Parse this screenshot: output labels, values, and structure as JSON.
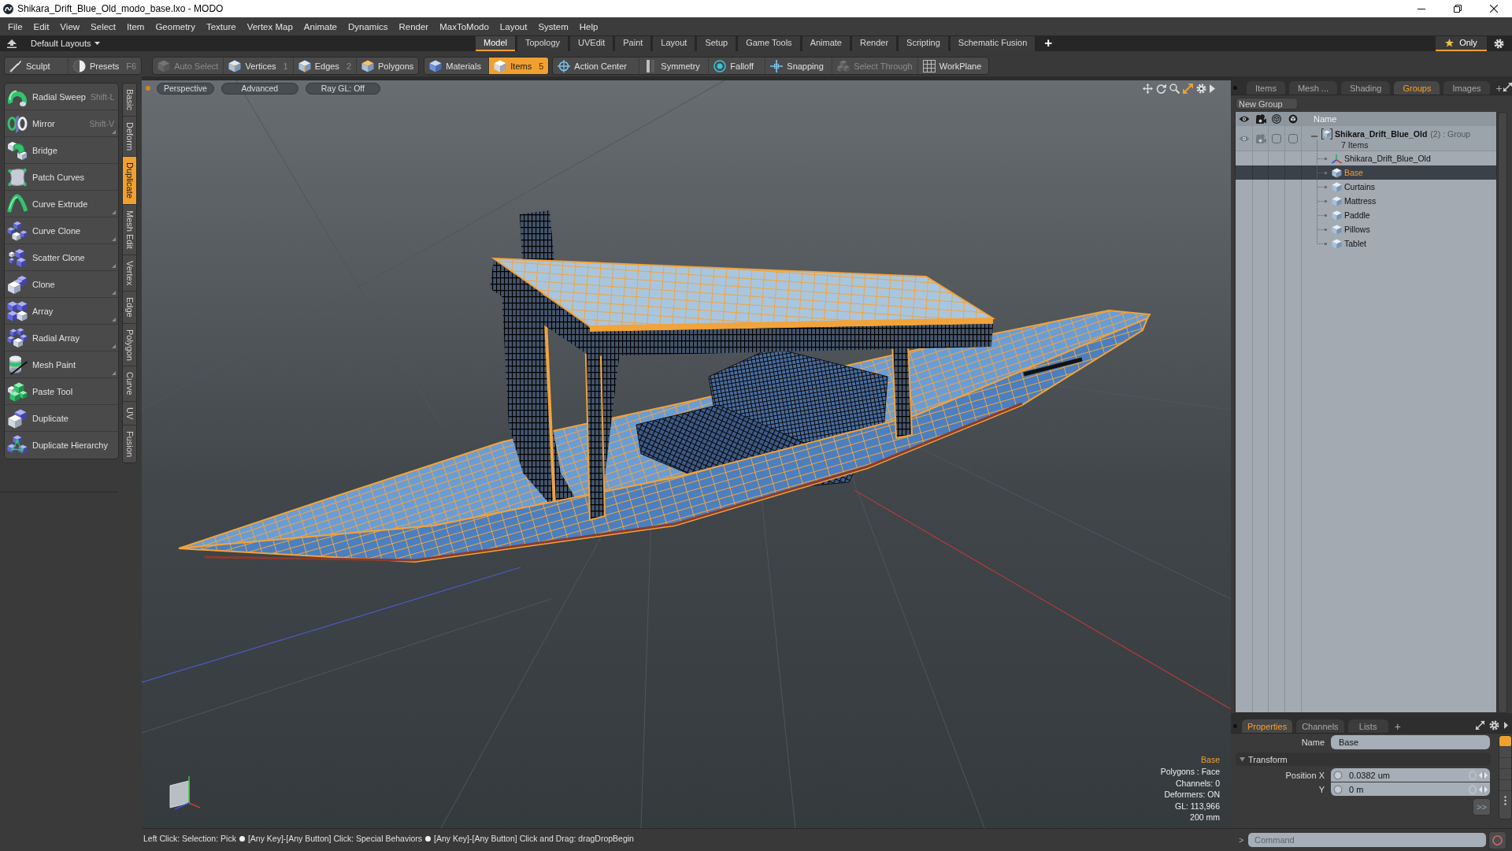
{
  "window": {
    "title": "Shikara_Drift_Blue_Old_modo_base.lxo - MODO"
  },
  "menu_bar": [
    "File",
    "Edit",
    "View",
    "Select",
    "Item",
    "Geometry",
    "Texture",
    "Vertex Map",
    "Animate",
    "Dynamics",
    "Render",
    "MaxToModo",
    "Layout",
    "System",
    "Help"
  ],
  "layout_bar": {
    "layouts_menu": "Default Layouts",
    "tabs": [
      {
        "label": "Model",
        "selected": true
      },
      {
        "label": "Topology",
        "selected": false
      },
      {
        "label": "UVEdit",
        "selected": false
      },
      {
        "label": "Paint",
        "selected": false
      },
      {
        "label": "Layout",
        "selected": false
      },
      {
        "label": "Setup",
        "selected": false
      },
      {
        "label": "Game Tools",
        "selected": false
      },
      {
        "label": "Animate",
        "selected": false
      },
      {
        "label": "Render",
        "selected": false
      },
      {
        "label": "Scripting",
        "selected": false
      },
      {
        "label": "Schematic Fusion",
        "selected": false
      }
    ],
    "add_tab": "+",
    "filter": {
      "label": "Only",
      "on": true
    }
  },
  "toolbar": {
    "groups": [
      {
        "items": [
          {
            "label": "Sculpt",
            "selected": false,
            "disabled": false
          },
          {
            "label": "Presets",
            "shortcut": "F6",
            "selected": false,
            "disabled": false
          }
        ]
      },
      {
        "items": [
          {
            "label": "Auto Select",
            "selected": false,
            "disabled": true
          },
          {
            "label": "Vertices",
            "shortcut": "1",
            "selected": false,
            "disabled": false
          },
          {
            "label": "Edges",
            "shortcut": "2",
            "selected": false,
            "disabled": false
          },
          {
            "label": "Polygons",
            "selected": false,
            "disabled": false
          }
        ]
      },
      {
        "items": [
          {
            "label": "Materials",
            "selected": false,
            "disabled": false
          },
          {
            "label": "Items",
            "shortcut": "5",
            "selected": true,
            "disabled": false
          }
        ]
      },
      {
        "items": [
          {
            "label": "Action Center",
            "selected": false,
            "disabled": false
          },
          {
            "label": "Symmetry",
            "selected": false,
            "disabled": false
          },
          {
            "label": "Falloff",
            "selected": false,
            "disabled": false
          },
          {
            "label": "Snapping",
            "selected": false,
            "disabled": false
          },
          {
            "label": "Select Through",
            "selected": false,
            "disabled": true
          },
          {
            "label": "WorkPlane",
            "selected": false,
            "disabled": false
          }
        ]
      }
    ]
  },
  "tool_panel": {
    "tools": [
      {
        "label": "Radial Sweep",
        "shortcut": "Shift-L",
        "has_options": false
      },
      {
        "label": "Mirror",
        "shortcut": "Shift-V",
        "has_options": true
      },
      {
        "label": "Bridge",
        "has_options": false
      },
      {
        "label": "Patch Curves",
        "has_options": false
      },
      {
        "label": "Curve Extrude",
        "has_options": true
      },
      {
        "label": "Curve Clone",
        "has_options": true
      },
      {
        "label": "Scatter Clone",
        "has_options": true
      },
      {
        "label": "Clone",
        "has_options": true
      },
      {
        "label": "Array",
        "has_options": true
      },
      {
        "label": "Radial Array",
        "has_options": true
      },
      {
        "label": "Mesh Paint",
        "has_options": true
      },
      {
        "label": "Paste Tool",
        "has_options": false
      },
      {
        "label": "Duplicate",
        "has_options": false
      },
      {
        "label": "Duplicate Hierarchy",
        "has_options": false
      }
    ],
    "tabs": [
      {
        "label": "Basic",
        "selected": false
      },
      {
        "label": "Deform",
        "selected": false
      },
      {
        "label": "Duplicate",
        "selected": true
      },
      {
        "label": "Mesh Edit",
        "selected": false
      },
      {
        "label": "Vertex",
        "selected": false
      },
      {
        "label": "Edge",
        "selected": false
      },
      {
        "label": "Polygon",
        "selected": false
      },
      {
        "label": "Curve",
        "selected": false
      },
      {
        "label": "UV",
        "selected": false
      },
      {
        "label": "Fusion",
        "selected": false
      }
    ]
  },
  "viewport": {
    "buttons": [
      "Perspective",
      "Advanced",
      "Ray GL: Off"
    ],
    "info": {
      "item": "Base",
      "lines": [
        "Polygons : Face",
        "Channels: 0",
        "Deformers: ON",
        "GL: 113,966",
        "200 mm"
      ]
    }
  },
  "groups_panel": {
    "tabs": [
      {
        "label": "Items",
        "selected": false
      },
      {
        "label": "Mesh ...",
        "selected": false
      },
      {
        "label": "Shading",
        "selected": false
      },
      {
        "label": "Groups",
        "selected": true
      },
      {
        "label": "Images",
        "selected": false
      }
    ],
    "add_tab": "+",
    "new_group": "New Group",
    "name_column": "Name",
    "tree": [
      {
        "name": "Shikara_Drift_Blue_Old",
        "count": "(2)",
        "type": ": Group",
        "summary": "7 Items",
        "expanded": true,
        "children": [
          {
            "name": "Shikara_Drift_Blue_Old",
            "kind": "locator",
            "selected": false
          },
          {
            "name": "Base",
            "kind": "mesh",
            "selected": true
          },
          {
            "name": "Curtains",
            "kind": "mesh",
            "selected": false
          },
          {
            "name": "Mattress",
            "kind": "mesh",
            "selected": false
          },
          {
            "name": "Paddle",
            "kind": "mesh",
            "selected": false
          },
          {
            "name": "Pillows",
            "kind": "mesh",
            "selected": false
          },
          {
            "name": "Tablet",
            "kind": "mesh",
            "selected": false
          }
        ]
      }
    ]
  },
  "properties_panel": {
    "tabs": [
      {
        "label": "Properties",
        "selected": true
      },
      {
        "label": "Channels",
        "selected": false
      },
      {
        "label": "Lists",
        "selected": false
      }
    ],
    "add_tab": "+",
    "name_label": "Name",
    "name_value": "Base",
    "section": {
      "label": "Transform",
      "expanded": true
    },
    "fields": [
      {
        "label": "Position X",
        "value": "0.0382 um"
      },
      {
        "label": "Y",
        "value": "0 m"
      }
    ],
    "more_button": ">>"
  },
  "command_bar": {
    "prompt": ">",
    "placeholder": "Command"
  },
  "status_bar": {
    "segments": [
      "Left Click: Selection: Pick",
      "[Any Key]-[Any Button] Click: Special Behaviors",
      "[Any Key]-[Any Button] Click and Drag: dragDropBegin"
    ]
  }
}
